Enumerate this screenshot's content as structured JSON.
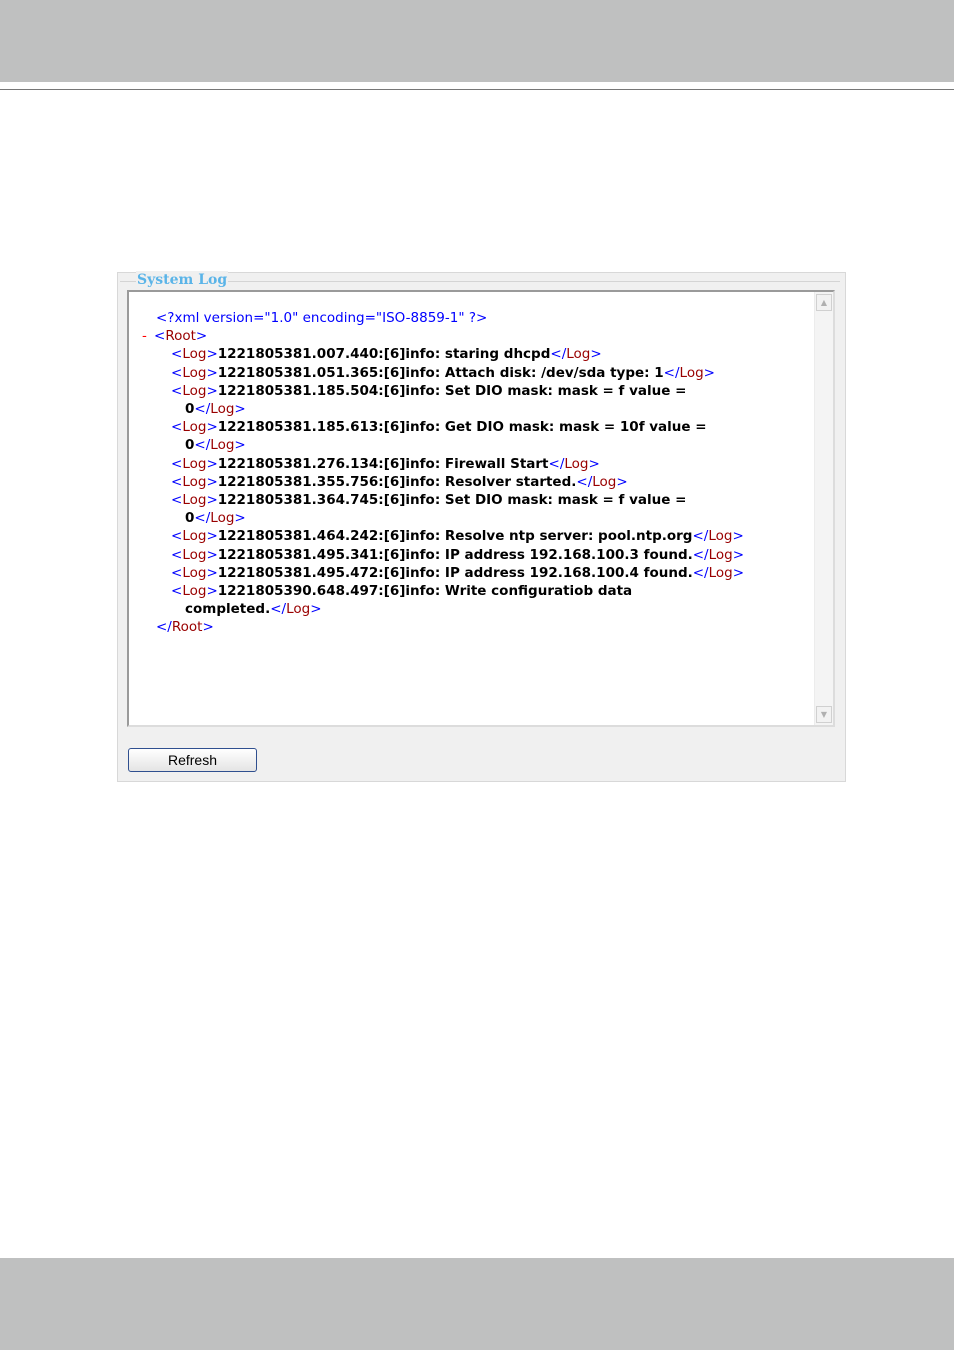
{
  "panel": {
    "title": "System Log"
  },
  "xml": {
    "declaration": "<?xml version=\"1.0\" encoding=\"ISO-8859-1\" ?>",
    "collapse_marker": "-",
    "root_tag": "Root",
    "entry_tag": "Log",
    "entries": [
      "1221805381.007.440:[6]info: staring dhcpd",
      "1221805381.051.365:[6]info: Attach disk: /dev/sda type: 1",
      "1221805381.185.504:[6]info: Set DIO mask: mask = f value =",
      "0",
      "1221805381.185.613:[6]info: Get DIO mask: mask = 10f value =",
      "0",
      "1221805381.276.134:[6]info: Firewall Start",
      "1221805381.355.756:[6]info: Resolver started.",
      "1221805381.364.745:[6]info: Set DIO mask: mask = f value =",
      "0",
      "1221805381.464.242:[6]info: Resolve ntp server: pool.ntp.org",
      "1221805381.495.341:[6]info: IP address 192.168.100.3 found.",
      "1221805381.495.472:[6]info: IP address 192.168.100.4 found.",
      "1221805390.648.497:[6]info: Write configuratiob data",
      "completed."
    ]
  },
  "scrollbar": {
    "up_icon": "chevron-up-icon",
    "down_icon": "chevron-down-icon",
    "up_glyph": "▲",
    "down_glyph": "▼"
  },
  "buttons": {
    "refresh_label": "Refresh"
  }
}
